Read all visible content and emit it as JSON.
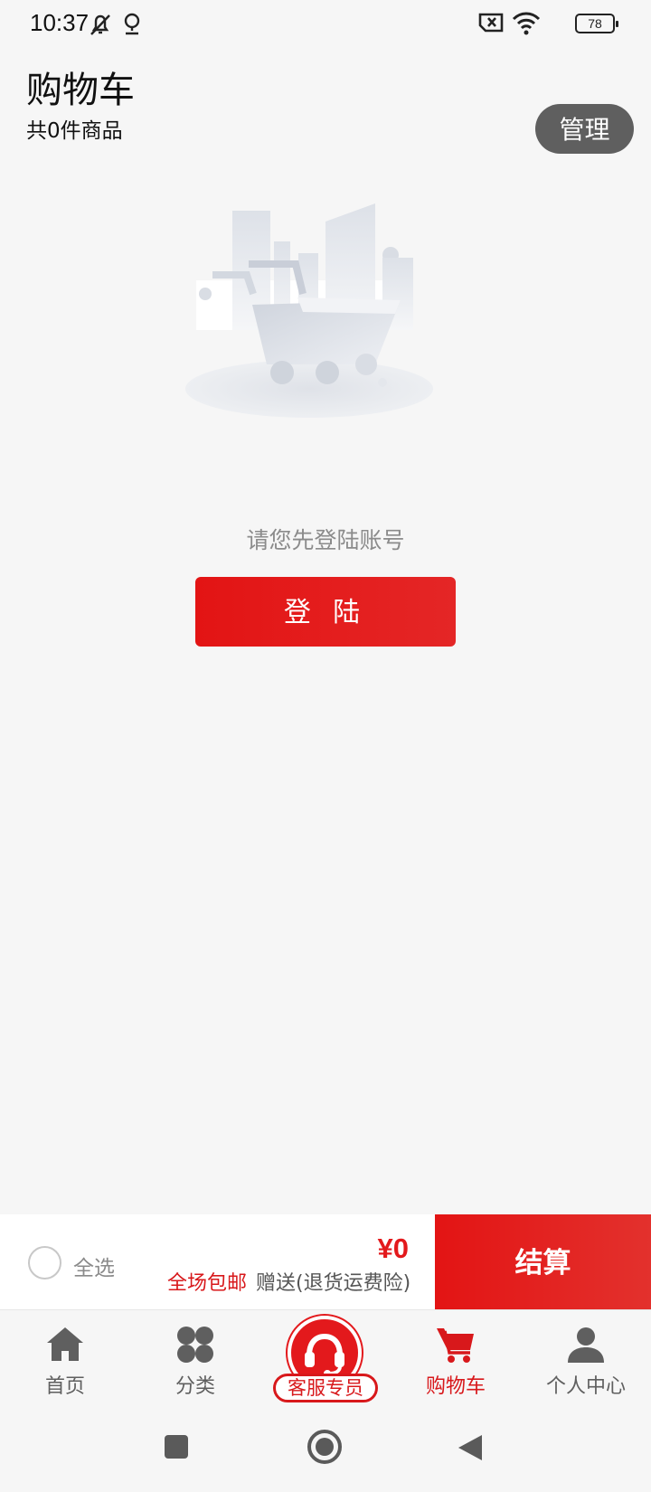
{
  "status_bar": {
    "time": "10:37",
    "battery": "78",
    "icons": [
      "notifications-muted-icon",
      "location-icon",
      "no-sim-icon",
      "wifi-icon",
      "battery-icon"
    ]
  },
  "header": {
    "title": "购物车",
    "item_count": "共0件商品",
    "manage_label": "管理"
  },
  "empty_state": {
    "illustration": "empty-cart-icon",
    "prompt": "请您先登陆账号",
    "login_label": "登 陆"
  },
  "checkout": {
    "select_all_label": "全选",
    "total_price": "¥0",
    "free_shipping": "全场包邮",
    "gift_note": "赠送(退货运费险)",
    "checkout_label": "结算"
  },
  "bottom_nav": {
    "items": [
      {
        "label": "首页",
        "icon": "home-icon"
      },
      {
        "label": "分类",
        "icon": "category-icon"
      },
      {
        "label": "客服专员",
        "icon": "headset-icon"
      },
      {
        "label": "购物车",
        "icon": "cart-icon"
      },
      {
        "label": "个人中心",
        "icon": "user-icon"
      }
    ],
    "active": "购物车"
  },
  "colors": {
    "accent": "#e3191c",
    "manage_button": "#5f5f5f",
    "background": "#f6f6f6"
  }
}
